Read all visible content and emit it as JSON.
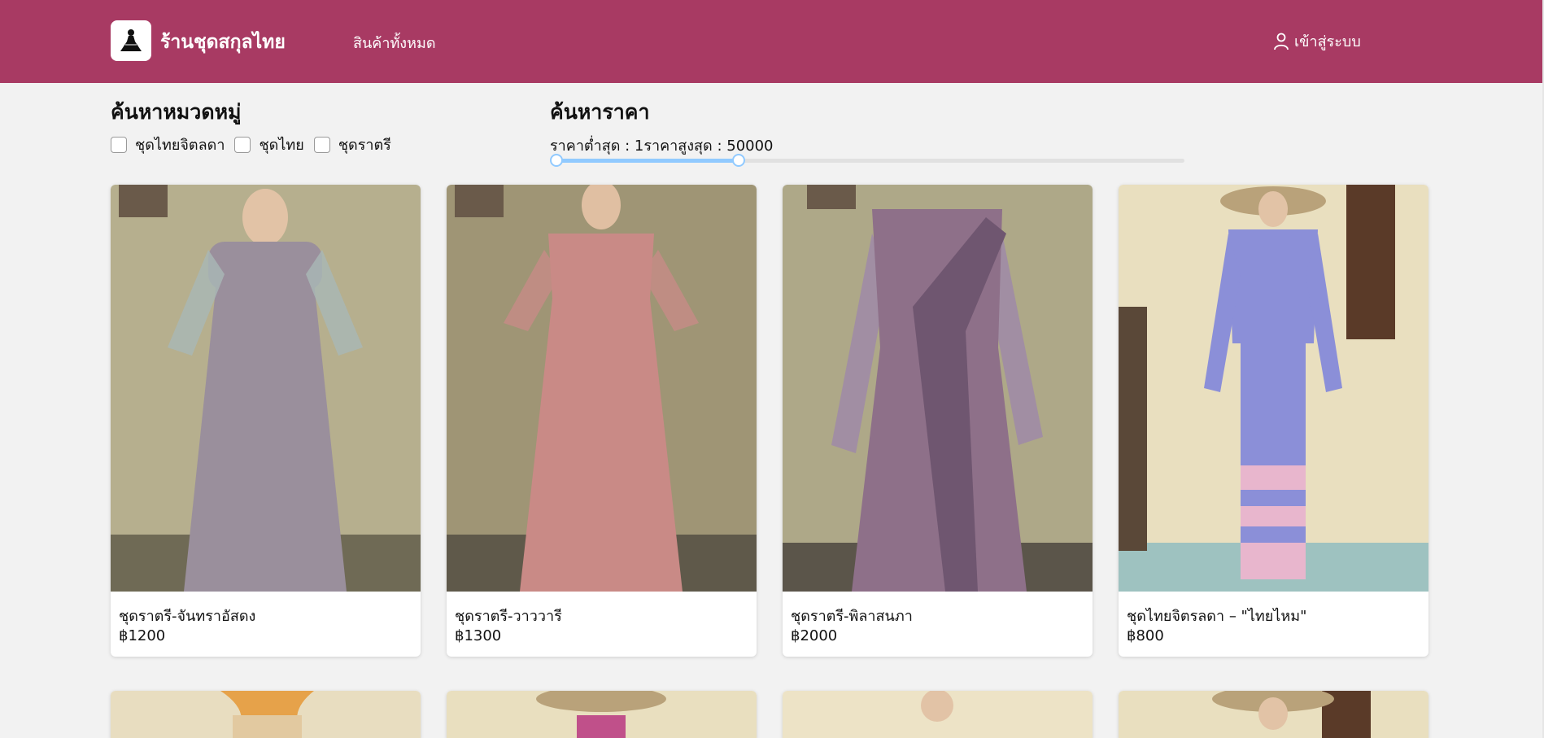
{
  "header": {
    "brand": "ร้านชุดสกุลไทย",
    "nav_all_products": "สินค้าทั้งหมด",
    "login": "เข้าสู่ระบบ",
    "logo_icon": "dress-logo-icon",
    "colors": {
      "bar": "#a83a63",
      "accent": "#91caff"
    }
  },
  "filters": {
    "category_heading": "ค้นหาหมวดหมู่",
    "categories": [
      "ชุดไทยจิตลดา",
      "ชุดไทย",
      "ชุดราตรี"
    ],
    "price_heading": "ค้นหาราคา",
    "price_text": "ราคาต่ำสุด : 1ราคาสูงสุด : 50000",
    "price_slider": {
      "min_value_fraction": 0.0,
      "max_value_fraction": 0.29
    }
  },
  "products": [
    {
      "name": "ชุดราตรี-จันทราอัสดง",
      "price": "฿1200",
      "dress_color": "#9a8f9c"
    },
    {
      "name": "ชุดราตรี-วาววารี",
      "price": "฿1300",
      "dress_color": "#c98a86"
    },
    {
      "name": "ชุดราตรี-พิลาสนภา",
      "price": "฿2000",
      "dress_color": "#8e7089"
    },
    {
      "name": "ชุดไทยจิตรลดา – \"ไทยไหม\"",
      "price": "฿800",
      "dress_color": "#8b8fd8"
    }
  ]
}
